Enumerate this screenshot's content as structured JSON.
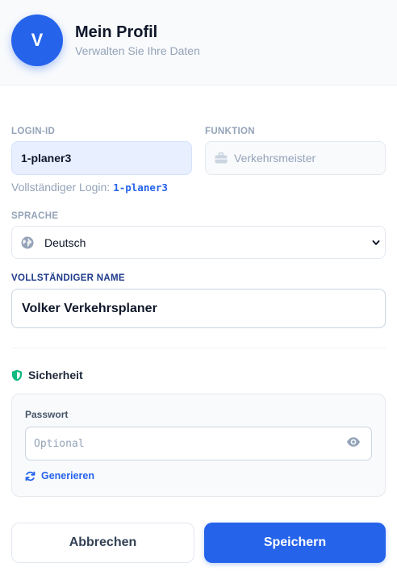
{
  "header": {
    "avatar_initial": "V",
    "title": "Mein Profil",
    "subtitle": "Verwalten Sie Ihre Daten"
  },
  "form": {
    "login": {
      "label": "LOGIN-ID",
      "value": "1-planer3"
    },
    "function": {
      "label": "FUNKTION",
      "value": "Verkehrsmeister",
      "icon": "briefcase-icon"
    },
    "full_login": {
      "prefix": "Vollständiger Login:",
      "value": "1-planer3"
    },
    "language": {
      "label": "SPRACHE",
      "value": "Deutsch",
      "icon": "globe-icon"
    },
    "full_name": {
      "label": "VOLLSTÄNDIGER NAME",
      "value": "Volker Verkehrsplaner"
    }
  },
  "security": {
    "heading": "Sicherheit",
    "password": {
      "label": "Passwort",
      "value": "",
      "placeholder": "Optional"
    },
    "generate_label": "Generieren"
  },
  "actions": {
    "cancel_label": "Abbrechen",
    "save_label": "Speichern"
  },
  "colors": {
    "primary": "#2563eb",
    "security_icon": "#10b981",
    "muted_text": "#94a3b8"
  }
}
